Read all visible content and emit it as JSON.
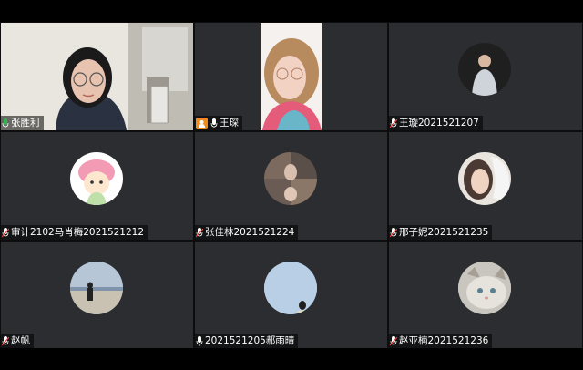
{
  "participants": [
    {
      "name": "张胜利",
      "muted": false,
      "speaking": true,
      "has_video": true
    },
    {
      "name": "王琛",
      "muted": false,
      "host": true,
      "has_video": true
    },
    {
      "name": "王璇2021521207",
      "muted": true
    },
    {
      "name": "审计2102马肖梅2021521212",
      "muted": true
    },
    {
      "name": "张佳林2021521224",
      "muted": true
    },
    {
      "name": "邢子妮2021521235",
      "muted": true
    },
    {
      "name": "赵帆",
      "muted": true
    },
    {
      "name": "2021521205郝雨晴",
      "muted": false
    },
    {
      "name": "赵亚楠2021521236",
      "muted": true
    }
  ],
  "colors": {
    "speaking_border": "#2fb84f",
    "host_badge": "#f08c1e",
    "tile_bg": "#2b2d30",
    "mic_muted": "#e04040"
  }
}
